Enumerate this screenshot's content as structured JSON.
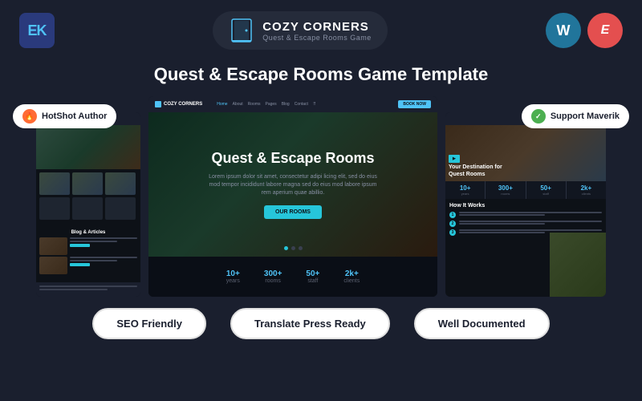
{
  "header": {
    "ek_label": "EK",
    "brand_name": "COZY CORNERS",
    "brand_tagline": "Quest & Escape Rooms Game",
    "wp_label": "W",
    "elementor_label": "E"
  },
  "page_title": "Quest & Escape Rooms Game Template",
  "badges": {
    "left_label": "HotShot Author",
    "right_label": "Support Maverik"
  },
  "center_preview": {
    "nav_logo": "COZY CORNERS",
    "nav_links": [
      "Home",
      "About",
      "Rooms",
      "Pages",
      "Blog",
      "Contact"
    ],
    "nav_cta": "BOOK NOW",
    "hero_title": "Quest & Escape Rooms",
    "hero_text": "Lorem ipsum dolor sit amet, consectetur adipi licing elit, sed do eius mod tempor incididunt labore magna sed do eius mod labore ipsum rem aperium quae abillio.",
    "hero_btn": "OUR ROOMS",
    "dots": [
      "active",
      "inactive",
      "inactive"
    ]
  },
  "right_preview": {
    "hero_title": "Your Destination for\nQuest Rooms",
    "stats": [
      {
        "num": "10+",
        "label": "years"
      },
      {
        "num": "300+",
        "label": "rooms"
      },
      {
        "num": "50+",
        "label": "staff"
      },
      {
        "num": "2k+",
        "label": "clients"
      }
    ],
    "how_it_works_title": "How It Works"
  },
  "left_preview": {
    "blog_title": "Blog & Articles"
  },
  "bottom_badges": {
    "seo": "SEO Friendly",
    "translate": "Translate Press Ready",
    "docs": "Well Documented"
  }
}
